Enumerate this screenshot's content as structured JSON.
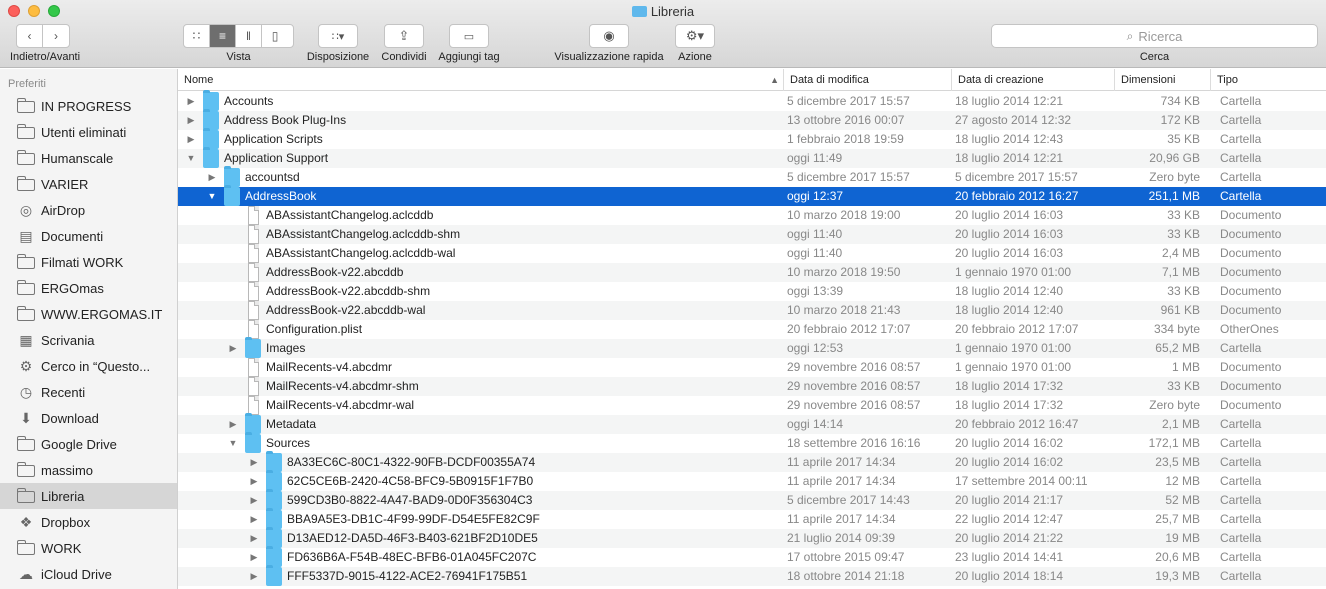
{
  "window": {
    "title": "Libreria"
  },
  "toolbar": {
    "nav_label": "Indietro/Avanti",
    "view_label": "Vista",
    "arrange_label": "Disposizione",
    "share_label": "Condividi",
    "tag_label": "Aggiungi tag",
    "quicklook_label": "Visualizzazione rapida",
    "action_label": "Azione",
    "search_placeholder": "Ricerca",
    "search_label": "Cerca"
  },
  "sidebar": {
    "header": "Preferiti",
    "items": [
      {
        "label": "IN PROGRESS",
        "icon": "folder-icon"
      },
      {
        "label": "Utenti eliminati",
        "icon": "folder-icon"
      },
      {
        "label": "Humanscale",
        "icon": "folder-icon"
      },
      {
        "label": "VARIER",
        "icon": "folder-icon"
      },
      {
        "label": "AirDrop",
        "icon": "airdrop-icon"
      },
      {
        "label": "Documenti",
        "icon": "document-icon"
      },
      {
        "label": "Filmati WORK",
        "icon": "folder-icon"
      },
      {
        "label": "ERGOmas",
        "icon": "folder-icon"
      },
      {
        "label": "WWW.ERGOMAS.IT",
        "icon": "folder-icon"
      },
      {
        "label": "Scrivania",
        "icon": "desktop-icon"
      },
      {
        "label": "Cerco in “Questo...",
        "icon": "gear-icon"
      },
      {
        "label": "Recenti",
        "icon": "clock-icon"
      },
      {
        "label": "Download",
        "icon": "download-icon"
      },
      {
        "label": "Google Drive",
        "icon": "folder-icon"
      },
      {
        "label": "massimo",
        "icon": "folder-icon"
      },
      {
        "label": "Libreria",
        "icon": "folder-icon",
        "selected": true
      },
      {
        "label": "Dropbox",
        "icon": "dropbox-icon"
      },
      {
        "label": "WORK",
        "icon": "folder-icon"
      },
      {
        "label": "iCloud Drive",
        "icon": "cloud-icon"
      }
    ]
  },
  "columns": {
    "name": "Nome",
    "modified": "Data di modifica",
    "created": "Data di creazione",
    "size": "Dimensioni",
    "kind": "Tipo"
  },
  "rows": [
    {
      "name": "Accounts",
      "modified": "5 dicembre 2017 15:57",
      "created": "18 luglio 2014 12:21",
      "size": "734 KB",
      "kind": "Cartella",
      "type": "folder",
      "depth": 0,
      "disclosure": "collapsed"
    },
    {
      "name": "Address Book Plug-Ins",
      "modified": "13 ottobre 2016 00:07",
      "created": "27 agosto 2014 12:32",
      "size": "172 KB",
      "kind": "Cartella",
      "type": "folder",
      "depth": 0,
      "disclosure": "collapsed"
    },
    {
      "name": "Application Scripts",
      "modified": "1 febbraio 2018 19:59",
      "created": "18 luglio 2014 12:43",
      "size": "35 KB",
      "kind": "Cartella",
      "type": "folder",
      "depth": 0,
      "disclosure": "collapsed"
    },
    {
      "name": "Application Support",
      "modified": "oggi 11:49",
      "created": "18 luglio 2014 12:21",
      "size": "20,96 GB",
      "kind": "Cartella",
      "type": "folder",
      "depth": 0,
      "disclosure": "expanded"
    },
    {
      "name": "accountsd",
      "modified": "5 dicembre 2017 15:57",
      "created": "5 dicembre 2017 15:57",
      "size": "Zero byte",
      "kind": "Cartella",
      "type": "folder",
      "depth": 1,
      "disclosure": "collapsed"
    },
    {
      "name": "AddressBook",
      "modified": "oggi 12:37",
      "created": "20 febbraio 2012 16:27",
      "size": "251,1 MB",
      "kind": "Cartella",
      "type": "folder",
      "depth": 1,
      "disclosure": "expanded",
      "selected": true
    },
    {
      "name": "ABAssistantChangelog.aclcddb",
      "modified": "10 marzo 2018 19:00",
      "created": "20 luglio 2014 16:03",
      "size": "33 KB",
      "kind": "Documento",
      "type": "doc",
      "depth": 2
    },
    {
      "name": "ABAssistantChangelog.aclcddb-shm",
      "modified": "oggi 11:40",
      "created": "20 luglio 2014 16:03",
      "size": "33 KB",
      "kind": "Documento",
      "type": "doc",
      "depth": 2
    },
    {
      "name": "ABAssistantChangelog.aclcddb-wal",
      "modified": "oggi 11:40",
      "created": "20 luglio 2014 16:03",
      "size": "2,4 MB",
      "kind": "Documento",
      "type": "doc",
      "depth": 2
    },
    {
      "name": "AddressBook-v22.abcddb",
      "modified": "10 marzo 2018 19:50",
      "created": "1 gennaio 1970 01:00",
      "size": "7,1 MB",
      "kind": "Documento",
      "type": "doc",
      "depth": 2
    },
    {
      "name": "AddressBook-v22.abcddb-shm",
      "modified": "oggi 13:39",
      "created": "18 luglio 2014 12:40",
      "size": "33 KB",
      "kind": "Documento",
      "type": "doc",
      "depth": 2
    },
    {
      "name": "AddressBook-v22.abcddb-wal",
      "modified": "10 marzo 2018 21:43",
      "created": "18 luglio 2014 12:40",
      "size": "961 KB",
      "kind": "Documento",
      "type": "doc",
      "depth": 2
    },
    {
      "name": "Configuration.plist",
      "modified": "20 febbraio 2012 17:07",
      "created": "20 febbraio 2012 17:07",
      "size": "334 byte",
      "kind": "OtherOnes",
      "type": "doc",
      "depth": 2
    },
    {
      "name": "Images",
      "modified": "oggi 12:53",
      "created": "1 gennaio 1970 01:00",
      "size": "65,2 MB",
      "kind": "Cartella",
      "type": "folder",
      "depth": 2,
      "disclosure": "collapsed"
    },
    {
      "name": "MailRecents-v4.abcdmr",
      "modified": "29 novembre 2016 08:57",
      "created": "1 gennaio 1970 01:00",
      "size": "1 MB",
      "kind": "Documento",
      "type": "doc",
      "depth": 2
    },
    {
      "name": "MailRecents-v4.abcdmr-shm",
      "modified": "29 novembre 2016 08:57",
      "created": "18 luglio 2014 17:32",
      "size": "33 KB",
      "kind": "Documento",
      "type": "doc",
      "depth": 2
    },
    {
      "name": "MailRecents-v4.abcdmr-wal",
      "modified": "29 novembre 2016 08:57",
      "created": "18 luglio 2014 17:32",
      "size": "Zero byte",
      "kind": "Documento",
      "type": "doc",
      "depth": 2
    },
    {
      "name": "Metadata",
      "modified": "oggi 14:14",
      "created": "20 febbraio 2012 16:47",
      "size": "2,1 MB",
      "kind": "Cartella",
      "type": "folder",
      "depth": 2,
      "disclosure": "collapsed"
    },
    {
      "name": "Sources",
      "modified": "18 settembre 2016 16:16",
      "created": "20 luglio 2014 16:02",
      "size": "172,1 MB",
      "kind": "Cartella",
      "type": "folder",
      "depth": 2,
      "disclosure": "expanded"
    },
    {
      "name": "8A33EC6C-80C1-4322-90FB-DCDF00355A74",
      "modified": "11 aprile 2017 14:34",
      "created": "20 luglio 2014 16:02",
      "size": "23,5 MB",
      "kind": "Cartella",
      "type": "folder",
      "depth": 3,
      "disclosure": "collapsed"
    },
    {
      "name": "62C5CE6B-2420-4C58-BFC9-5B0915F1F7B0",
      "modified": "11 aprile 2017 14:34",
      "created": "17 settembre 2014 00:11",
      "size": "12 MB",
      "kind": "Cartella",
      "type": "folder",
      "depth": 3,
      "disclosure": "collapsed"
    },
    {
      "name": "599CD3B0-8822-4A47-BAD9-0D0F356304C3",
      "modified": "5 dicembre 2017 14:43",
      "created": "20 luglio 2014 21:17",
      "size": "52 MB",
      "kind": "Cartella",
      "type": "folder",
      "depth": 3,
      "disclosure": "collapsed"
    },
    {
      "name": "BBA9A5E3-DB1C-4F99-99DF-D54E5FE82C9F",
      "modified": "11 aprile 2017 14:34",
      "created": "22 luglio 2014 12:47",
      "size": "25,7 MB",
      "kind": "Cartella",
      "type": "folder",
      "depth": 3,
      "disclosure": "collapsed"
    },
    {
      "name": "D13AED12-DA5D-46F3-B403-621BF2D10DE5",
      "modified": "21 luglio 2014 09:39",
      "created": "20 luglio 2014 21:22",
      "size": "19 MB",
      "kind": "Cartella",
      "type": "folder",
      "depth": 3,
      "disclosure": "collapsed"
    },
    {
      "name": "FD636B6A-F54B-48EC-BFB6-01A045FC207C",
      "modified": "17 ottobre 2015 09:47",
      "created": "23 luglio 2014 14:41",
      "size": "20,6 MB",
      "kind": "Cartella",
      "type": "folder",
      "depth": 3,
      "disclosure": "collapsed"
    },
    {
      "name": "FFF5337D-9015-4122-ACE2-76941F175B51",
      "modified": "18 ottobre 2014 21:18",
      "created": "20 luglio 2014 18:14",
      "size": "19,3 MB",
      "kind": "Cartella",
      "type": "folder",
      "depth": 3,
      "disclosure": "collapsed"
    }
  ]
}
